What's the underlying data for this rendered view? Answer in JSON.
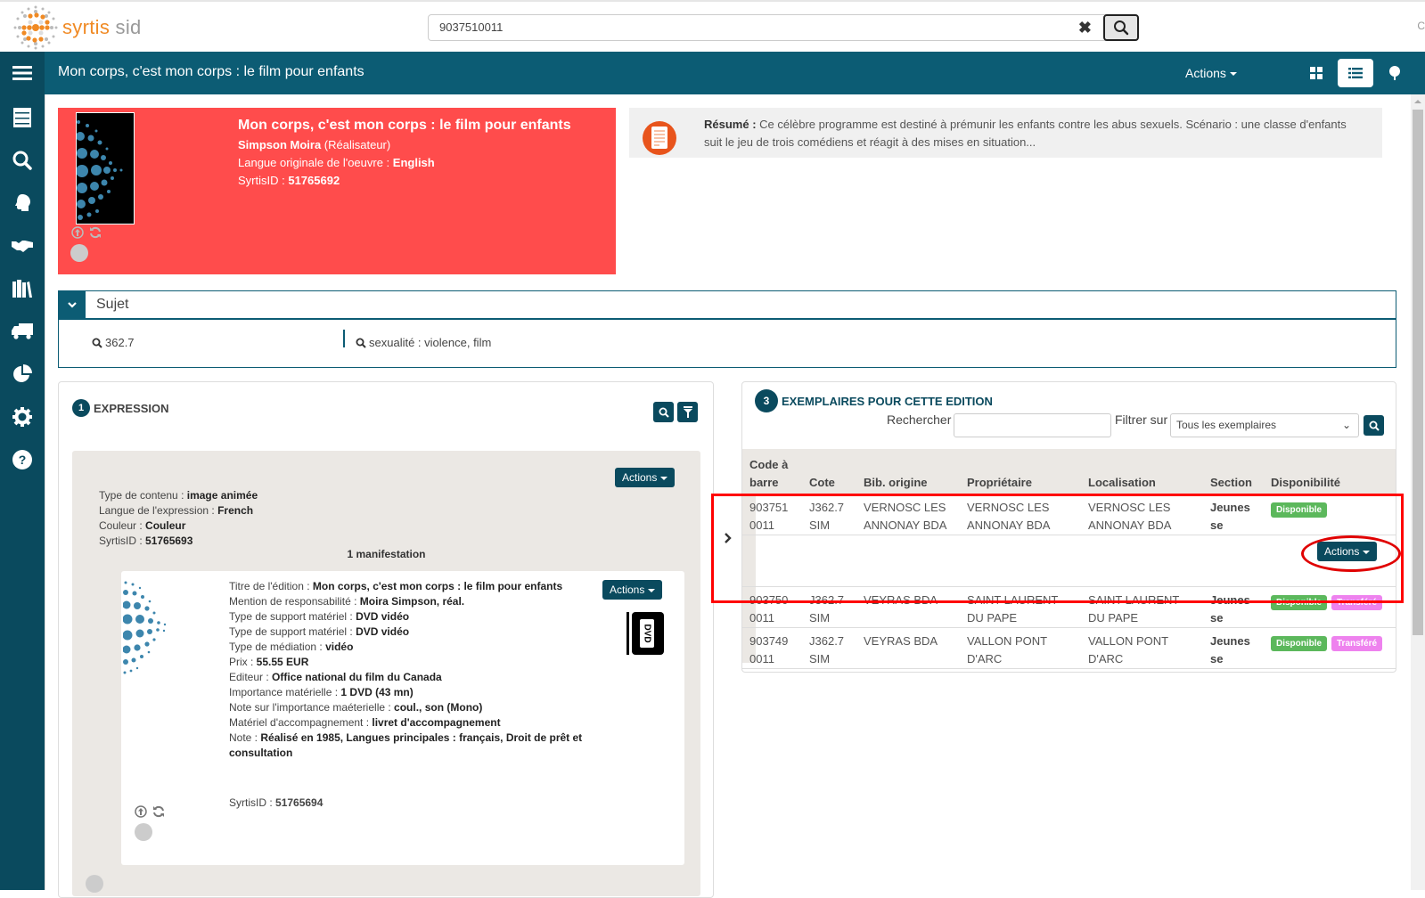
{
  "app": {
    "logo_word1": "syrtis",
    "logo_word2": " sid",
    "brand_color": "#0c5c74",
    "accent_color": "#f08a24"
  },
  "search": {
    "value": "9037510011",
    "clear_glyph": "✖"
  },
  "topbar": {
    "cut_text": "C"
  },
  "navbar": {
    "title": "Mon corps, c'est mon corps : le film pour enfants",
    "actions_label": "Actions"
  },
  "sidebar": {
    "items": [
      {
        "name": "catalog"
      },
      {
        "name": "search"
      },
      {
        "name": "user"
      },
      {
        "name": "handshake"
      },
      {
        "name": "library"
      },
      {
        "name": "truck"
      },
      {
        "name": "stats"
      },
      {
        "name": "settings"
      },
      {
        "name": "help"
      }
    ]
  },
  "work": {
    "title": "Mon corps, c'est mon corps : le film pour enfants",
    "author_name": "Simpson Moira",
    "author_role": " (Réalisateur)",
    "lang_label": "Langue originale de l'oeuvre : ",
    "lang_value": "English",
    "id_label": "SyrtisID : ",
    "id_value": "51765692",
    "card_color": "#ff4c4c"
  },
  "resume": {
    "label": "Résumé :",
    "text": " Ce célèbre programme est destiné à prémunir les enfants contre les abus sexuels. Scénario : une classe d'enfants suit le jeu de trois comédiens et réagit à des mises en situation..."
  },
  "subject": {
    "title": "Sujet",
    "tags": [
      "362.7",
      "sexualité : violence, film"
    ]
  },
  "expression": {
    "number": "1",
    "title": "EXPRESSION",
    "actions_label": "Actions",
    "fields": [
      {
        "label": "Type de contenu : ",
        "value": "image animée"
      },
      {
        "label": "Langue de l'expression : ",
        "value": "French"
      },
      {
        "label": "Couleur : ",
        "value": "Couleur"
      },
      {
        "label": "SyrtisID : ",
        "value": "51765693"
      }
    ],
    "manif_count": "1 manifestation"
  },
  "manifestation": {
    "actions_label": "Actions",
    "fields": [
      {
        "label": "Titre de l'édition : ",
        "value": "Mon corps, c'est mon corps : le film pour enfants"
      },
      {
        "label": "Mention de responsabilité : ",
        "value": "Moira Simpson, réal."
      },
      {
        "label": "Type de support matériel : ",
        "value": "DVD vidéo"
      },
      {
        "label": "Type de support matériel : ",
        "value": "DVD vidéo"
      },
      {
        "label": "Type de médiation : ",
        "value": "vidéo"
      },
      {
        "label": "Prix : ",
        "value": "55.55 EUR"
      },
      {
        "label": "Editeur : ",
        "value": "Office national du film du Canada"
      },
      {
        "label": "Importance matérielle : ",
        "value": "1 DVD (43 mn)"
      },
      {
        "label": "Note sur l'importance maéterielle : ",
        "value": "coul., son (Mono)"
      },
      {
        "label": "Matériel d'accompagnement : ",
        "value": "livret d'accompagnement"
      },
      {
        "label": "Note : ",
        "value": "Réalisé en 1985,  Langues principales : français,  Droit de prêt et consultation"
      }
    ],
    "id_label": "SyrtisID : ",
    "id_value": "51765694",
    "dvd_label": "DVD"
  },
  "exemplaires": {
    "number": "3",
    "title": "EXEMPLAIRES POUR CETTE EDITION",
    "search_label": "Rechercher",
    "search_value": "",
    "filter_label": "Filtrer sur",
    "filter_value": "Tous les exemplaires",
    "columns": [
      "Code à barre",
      "Cote",
      "Bib. origine",
      "Propriétaire",
      "Localisation",
      "Section",
      "Disponibilité"
    ],
    "rows": [
      {
        "barcode": [
          "903751",
          "0011"
        ],
        "cote": [
          "J362.7",
          "SIM"
        ],
        "origine": [
          "VERNOSC LES",
          "ANNONAY BDA"
        ],
        "proprietaire": [
          "VERNOSC LES",
          "ANNONAY BDA"
        ],
        "localisation": [
          "VERNOSC LES",
          "ANNONAY BDA"
        ],
        "section": [
          "Jeunes",
          "se"
        ],
        "badges": [
          "Disponible"
        ],
        "expanded": true,
        "actions_label": "Actions"
      },
      {
        "barcode": [
          "903750",
          "0011"
        ],
        "cote": [
          "J362.7",
          "SIM"
        ],
        "origine": [
          "VEYRAS BDA",
          ""
        ],
        "proprietaire": [
          "SAINT LAURENT",
          "DU PAPE"
        ],
        "localisation": [
          "SAINT LAURENT",
          "DU PAPE"
        ],
        "section": [
          "Jeunes",
          "se"
        ],
        "badges": [
          "Disponible",
          "Transféré"
        ]
      },
      {
        "barcode": [
          "903749",
          "0011"
        ],
        "cote": [
          "J362.7",
          "SIM"
        ],
        "origine": [
          "VEYRAS BDA",
          ""
        ],
        "proprietaire": [
          "VALLON PONT",
          "D'ARC"
        ],
        "localisation": [
          "VALLON PONT",
          "D'ARC"
        ],
        "section": [
          "Jeunes",
          "se"
        ],
        "badges": [
          "Disponible",
          "Transféré"
        ]
      }
    ],
    "badge_colors": {
      "Disponible": "#5cb85c",
      "Transféré": "#ee82ee"
    }
  }
}
